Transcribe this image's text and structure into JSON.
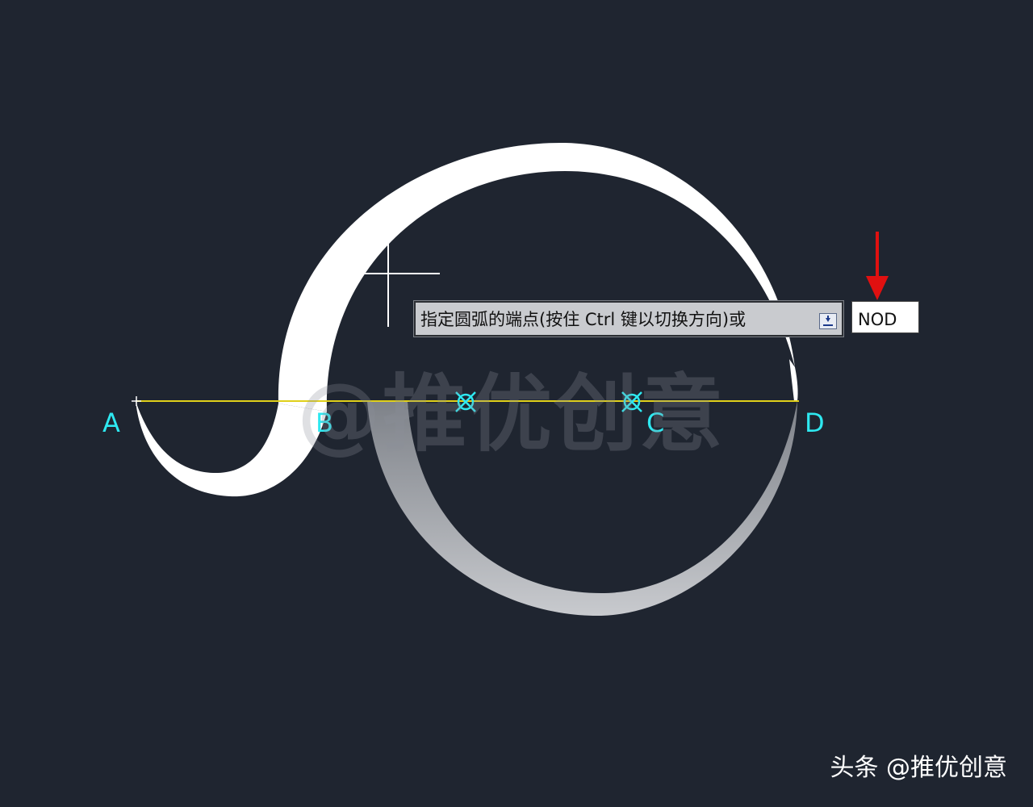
{
  "drawing": {
    "colors": {
      "background": "#1f2530",
      "label": "#2ee8f0",
      "baseline": "#e0d01a",
      "arc_white": "#ffffff",
      "arc_preview": "#b6b9be",
      "pointer_arrow": "#e01010"
    },
    "point_labels": {
      "a": "A",
      "b": "B",
      "c": "C",
      "d": "D"
    }
  },
  "command_prompt": {
    "text": "指定圆弧的端点(按住 Ctrl 键以切换方向)或",
    "options_icon": "dropdown-menu-icon"
  },
  "command_input": {
    "value": "NOD"
  },
  "watermark": {
    "text": "@推优创意"
  },
  "source_credit": {
    "text": "头条 @推优创意"
  }
}
